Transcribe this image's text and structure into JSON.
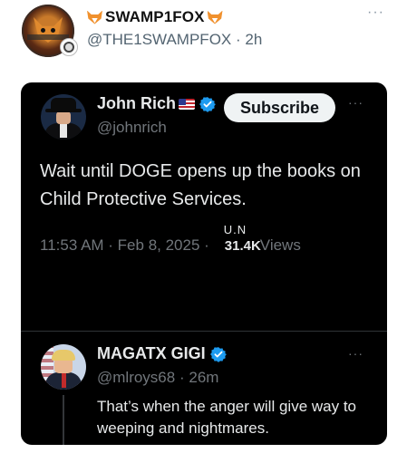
{
  "outer_post": {
    "display_name": "SWAMP1FOX",
    "handle": "@THE1SWAMPFOX",
    "separator": "·",
    "time": "2h",
    "more": "···"
  },
  "embedded_tweet": {
    "display_name": "John Rich",
    "handle": "@johnrich",
    "subscribe_label": "Subscribe",
    "more": "···",
    "text": "Wait until DOGE opens up the books on Child Protective Services.",
    "time": "11:53 AM · Feb 8, 2025 ·",
    "views_ghost": "U.N",
    "views_count": "31.4K",
    "views_label": "Views"
  },
  "reply": {
    "display_name": "MAGATX GIGI",
    "handle": "@mlroys68",
    "separator": "·",
    "time": "26m",
    "more": "···",
    "text": "That’s when the anger will give way to weeping and nightmares."
  },
  "colors": {
    "background": "#ffffff",
    "embed_background": "#000000",
    "verified_blue": "#1d9bf0",
    "muted_text_dark": "#71767b",
    "muted_text_light": "#536471"
  },
  "icons": [
    "fox-emoji-icon",
    "us-flag-icon",
    "verified-badge-icon",
    "more-icon"
  ]
}
